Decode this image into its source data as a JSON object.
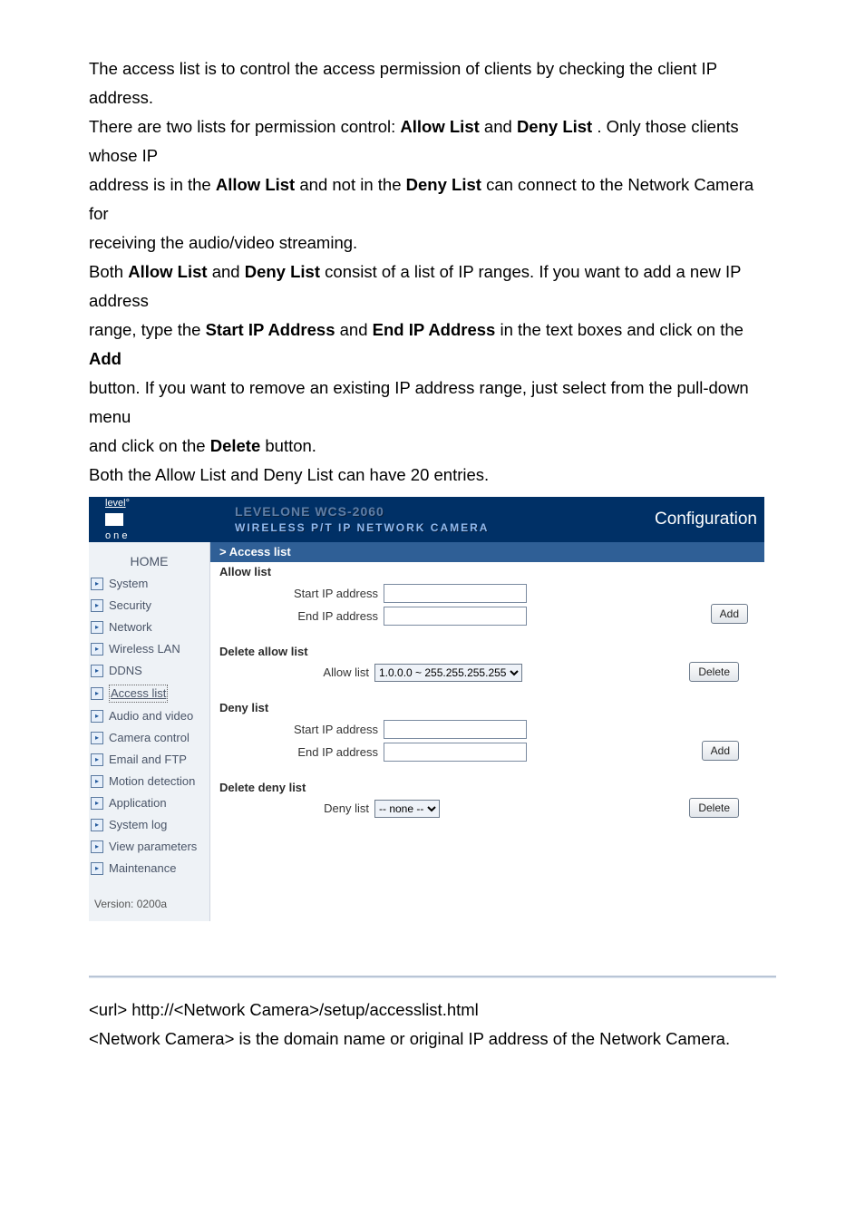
{
  "doc": {
    "intro_l1_a": "The access list is to control the access permission of clients by checking the client IP address.",
    "intro_l2_a": "There are two lists for permission control: ",
    "intro_l2_b": "Allow List",
    "intro_l2_c": " and ",
    "intro_l2_d": "Deny List",
    "intro_l2_e": ". Only those clients whose IP",
    "intro_l3_a": "address is in the ",
    "intro_l3_b": "Allow List",
    "intro_l3_c": " and not in the ",
    "intro_l3_d": "Deny List",
    "intro_l3_e": " can connect to the Network Camera for",
    "intro_l4": "receiving the audio/video streaming.",
    "intro_l5_a": "Both ",
    "intro_l5_b": "Allow List",
    "intro_l5_c": " and ",
    "intro_l5_d": "Deny List",
    "intro_l5_e": " consist of a list of IP ranges. If you want to add a new IP address",
    "intro_l6_a": "range, type the ",
    "intro_l6_b": "Start IP Address",
    "intro_l6_c": " and ",
    "intro_l6_d": "End IP Address",
    "intro_l6_e": " in the text boxes and click on the ",
    "intro_l6_f": "Add",
    "intro_l7_a": "button. If you want to remove an existing IP address range, just select from the pull-down menu",
    "intro_l8_a": "and click on the ",
    "intro_l8_b": "Delete",
    "intro_l8_c": " button.",
    "intro_l9": "Both the Allow List and Deny List can have 20 entries.",
    "url_line": "<url> http://<Network Camera>/setup/accesslist.html",
    "url_note": "<Network Camera> is the domain name or original IP address of the Network Camera."
  },
  "shot": {
    "logo_top": "level",
    "logo_bottom": "o n e",
    "product_line1": "LEVELONE WCS-2060",
    "product_line2": "WIRELESS P/T IP NETWORK CAMERA",
    "config_label": "Configuration",
    "sidebar": {
      "home": "HOME",
      "items": [
        {
          "label": "System"
        },
        {
          "label": "Security"
        },
        {
          "label": "Network"
        },
        {
          "label": "Wireless LAN"
        },
        {
          "label": "DDNS"
        },
        {
          "label": "Access list",
          "selected": true
        },
        {
          "label": "Audio and video"
        },
        {
          "label": "Camera control"
        },
        {
          "label": "Email and FTP"
        },
        {
          "label": "Motion detection"
        },
        {
          "label": "Application"
        },
        {
          "label": "System log"
        },
        {
          "label": "View parameters"
        },
        {
          "label": "Maintenance"
        }
      ],
      "version": "Version: 0200a"
    },
    "main": {
      "crumb": "> Access list",
      "allow_title": "Allow list",
      "start_ip_label": "Start IP address",
      "end_ip_label": "End IP address",
      "add_btn": "Add",
      "del_allow_title": "Delete allow list",
      "allow_list_label": "Allow list",
      "allow_list_value": "1.0.0.0 ~ 255.255.255.255",
      "deny_title": "Deny list",
      "del_deny_title": "Delete deny list",
      "deny_list_label": "Deny list",
      "deny_list_value": "-- none --",
      "delete_btn": "Delete"
    }
  }
}
